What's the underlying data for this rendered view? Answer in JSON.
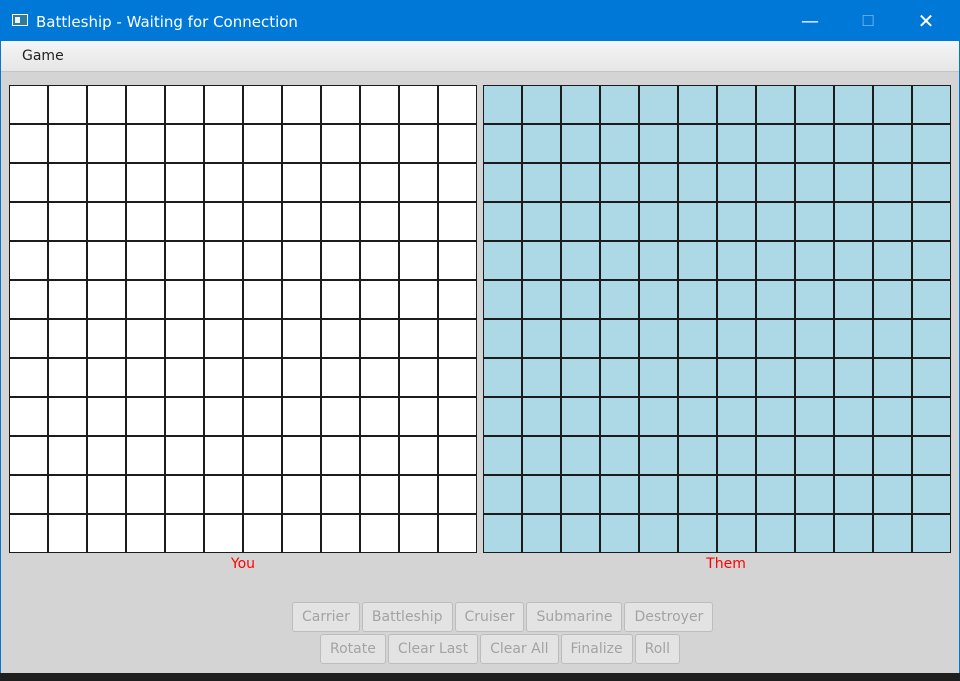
{
  "window": {
    "title": "Battleship - Waiting for Connection",
    "controls": {
      "minimize": "—",
      "maximize": "☐",
      "close": "✕"
    }
  },
  "menubar": {
    "items": [
      "Game"
    ]
  },
  "boards": {
    "rows": 12,
    "cols": 12,
    "you": {
      "label": "You",
      "cell_color": "#ffffff"
    },
    "them": {
      "label": "Them",
      "cell_color": "#add8e6"
    }
  },
  "ship_buttons": [
    "Carrier",
    "Battleship",
    "Cruiser",
    "Submarine",
    "Destroyer"
  ],
  "action_buttons": [
    "Rotate",
    "Clear Last",
    "Clear All",
    "Finalize",
    "Roll"
  ],
  "colors": {
    "titlebar": "#0078d7",
    "label_text": "#ff0000",
    "disabled_text": "#a3a3a3"
  }
}
